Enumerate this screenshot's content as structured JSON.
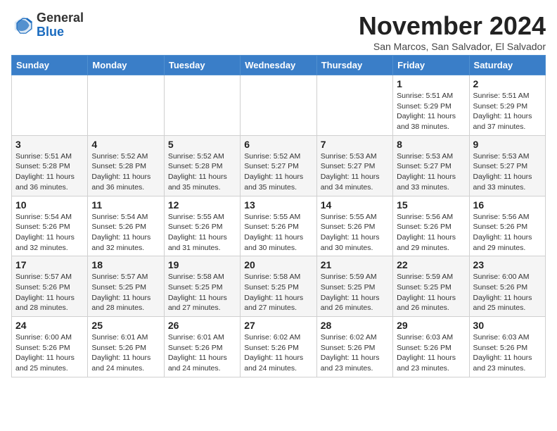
{
  "logo": {
    "general": "General",
    "blue": "Blue"
  },
  "header": {
    "month_title": "November 2024",
    "subtitle": "San Marcos, San Salvador, El Salvador"
  },
  "weekdays": [
    "Sunday",
    "Monday",
    "Tuesday",
    "Wednesday",
    "Thursday",
    "Friday",
    "Saturday"
  ],
  "weeks": [
    [
      {
        "day": "",
        "info": ""
      },
      {
        "day": "",
        "info": ""
      },
      {
        "day": "",
        "info": ""
      },
      {
        "day": "",
        "info": ""
      },
      {
        "day": "",
        "info": ""
      },
      {
        "day": "1",
        "info": "Sunrise: 5:51 AM\nSunset: 5:29 PM\nDaylight: 11 hours\nand 38 minutes."
      },
      {
        "day": "2",
        "info": "Sunrise: 5:51 AM\nSunset: 5:29 PM\nDaylight: 11 hours\nand 37 minutes."
      }
    ],
    [
      {
        "day": "3",
        "info": "Sunrise: 5:51 AM\nSunset: 5:28 PM\nDaylight: 11 hours\nand 36 minutes."
      },
      {
        "day": "4",
        "info": "Sunrise: 5:52 AM\nSunset: 5:28 PM\nDaylight: 11 hours\nand 36 minutes."
      },
      {
        "day": "5",
        "info": "Sunrise: 5:52 AM\nSunset: 5:28 PM\nDaylight: 11 hours\nand 35 minutes."
      },
      {
        "day": "6",
        "info": "Sunrise: 5:52 AM\nSunset: 5:27 PM\nDaylight: 11 hours\nand 35 minutes."
      },
      {
        "day": "7",
        "info": "Sunrise: 5:53 AM\nSunset: 5:27 PM\nDaylight: 11 hours\nand 34 minutes."
      },
      {
        "day": "8",
        "info": "Sunrise: 5:53 AM\nSunset: 5:27 PM\nDaylight: 11 hours\nand 33 minutes."
      },
      {
        "day": "9",
        "info": "Sunrise: 5:53 AM\nSunset: 5:27 PM\nDaylight: 11 hours\nand 33 minutes."
      }
    ],
    [
      {
        "day": "10",
        "info": "Sunrise: 5:54 AM\nSunset: 5:26 PM\nDaylight: 11 hours\nand 32 minutes."
      },
      {
        "day": "11",
        "info": "Sunrise: 5:54 AM\nSunset: 5:26 PM\nDaylight: 11 hours\nand 32 minutes."
      },
      {
        "day": "12",
        "info": "Sunrise: 5:55 AM\nSunset: 5:26 PM\nDaylight: 11 hours\nand 31 minutes."
      },
      {
        "day": "13",
        "info": "Sunrise: 5:55 AM\nSunset: 5:26 PM\nDaylight: 11 hours\nand 30 minutes."
      },
      {
        "day": "14",
        "info": "Sunrise: 5:55 AM\nSunset: 5:26 PM\nDaylight: 11 hours\nand 30 minutes."
      },
      {
        "day": "15",
        "info": "Sunrise: 5:56 AM\nSunset: 5:26 PM\nDaylight: 11 hours\nand 29 minutes."
      },
      {
        "day": "16",
        "info": "Sunrise: 5:56 AM\nSunset: 5:26 PM\nDaylight: 11 hours\nand 29 minutes."
      }
    ],
    [
      {
        "day": "17",
        "info": "Sunrise: 5:57 AM\nSunset: 5:26 PM\nDaylight: 11 hours\nand 28 minutes."
      },
      {
        "day": "18",
        "info": "Sunrise: 5:57 AM\nSunset: 5:25 PM\nDaylight: 11 hours\nand 28 minutes."
      },
      {
        "day": "19",
        "info": "Sunrise: 5:58 AM\nSunset: 5:25 PM\nDaylight: 11 hours\nand 27 minutes."
      },
      {
        "day": "20",
        "info": "Sunrise: 5:58 AM\nSunset: 5:25 PM\nDaylight: 11 hours\nand 27 minutes."
      },
      {
        "day": "21",
        "info": "Sunrise: 5:59 AM\nSunset: 5:25 PM\nDaylight: 11 hours\nand 26 minutes."
      },
      {
        "day": "22",
        "info": "Sunrise: 5:59 AM\nSunset: 5:25 PM\nDaylight: 11 hours\nand 26 minutes."
      },
      {
        "day": "23",
        "info": "Sunrise: 6:00 AM\nSunset: 5:26 PM\nDaylight: 11 hours\nand 25 minutes."
      }
    ],
    [
      {
        "day": "24",
        "info": "Sunrise: 6:00 AM\nSunset: 5:26 PM\nDaylight: 11 hours\nand 25 minutes."
      },
      {
        "day": "25",
        "info": "Sunrise: 6:01 AM\nSunset: 5:26 PM\nDaylight: 11 hours\nand 24 minutes."
      },
      {
        "day": "26",
        "info": "Sunrise: 6:01 AM\nSunset: 5:26 PM\nDaylight: 11 hours\nand 24 minutes."
      },
      {
        "day": "27",
        "info": "Sunrise: 6:02 AM\nSunset: 5:26 PM\nDaylight: 11 hours\nand 24 minutes."
      },
      {
        "day": "28",
        "info": "Sunrise: 6:02 AM\nSunset: 5:26 PM\nDaylight: 11 hours\nand 23 minutes."
      },
      {
        "day": "29",
        "info": "Sunrise: 6:03 AM\nSunset: 5:26 PM\nDaylight: 11 hours\nand 23 minutes."
      },
      {
        "day": "30",
        "info": "Sunrise: 6:03 AM\nSunset: 5:26 PM\nDaylight: 11 hours\nand 23 minutes."
      }
    ]
  ]
}
